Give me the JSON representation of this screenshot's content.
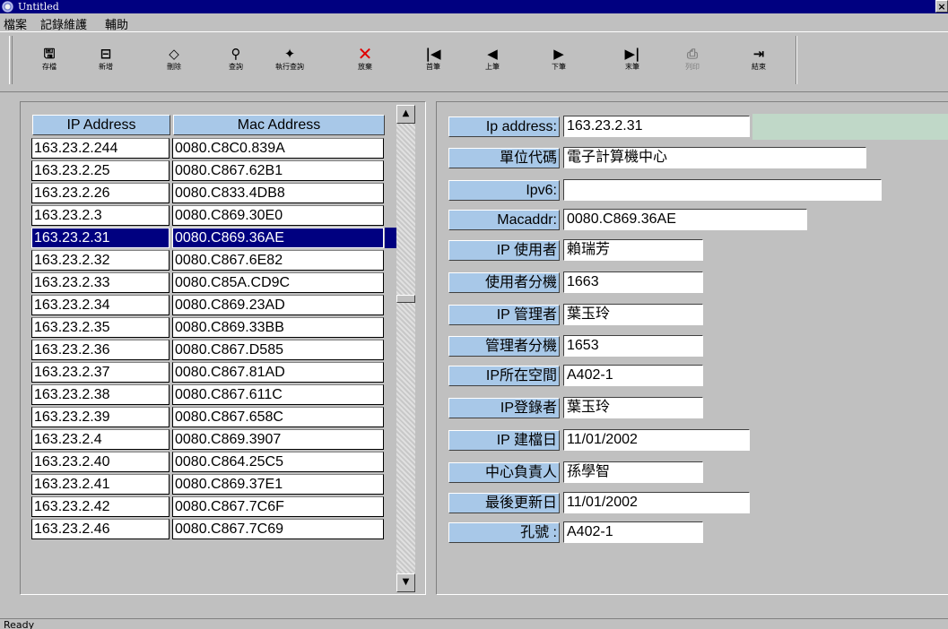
{
  "window": {
    "title": "Untitled",
    "close_glyph": "×"
  },
  "menu": [
    "檔案",
    "記錄維護",
    "輔助"
  ],
  "toolbar": [
    {
      "icon": "save-icon",
      "glyph": "🖫",
      "label": "存檔",
      "enabled": true
    },
    {
      "icon": "new-record-icon",
      "glyph": "⊟",
      "label": "新增",
      "enabled": true
    },
    {
      "icon": "erase-icon",
      "glyph": "◇",
      "label": "刪除",
      "enabled": true
    },
    {
      "icon": "query-icon",
      "glyph": "⚲",
      "label": "查詢",
      "enabled": true
    },
    {
      "icon": "execute-query-icon",
      "glyph": "✦",
      "label": "執行查詢",
      "enabled": true
    },
    {
      "icon": "cancel-icon",
      "glyph": "✕",
      "label": "放棄",
      "enabled": true
    },
    {
      "icon": "first-record-icon",
      "glyph": "|◀",
      "label": "首筆",
      "enabled": true
    },
    {
      "icon": "previous-record-icon",
      "glyph": "◀",
      "label": "上筆",
      "enabled": true
    },
    {
      "icon": "next-record-icon",
      "glyph": "▶",
      "label": "下筆",
      "enabled": true
    },
    {
      "icon": "last-record-icon",
      "glyph": "▶|",
      "label": "末筆",
      "enabled": true
    },
    {
      "icon": "print-icon",
      "glyph": "⎙",
      "label": "列印",
      "enabled": false
    },
    {
      "icon": "exit-icon",
      "glyph": "⇥",
      "label": "結束",
      "enabled": true
    }
  ],
  "list": {
    "columns": [
      "IP Address",
      "Mac Address"
    ],
    "selected_index": 4,
    "rows": [
      [
        "163.23.2.244",
        "0080.C8C0.839A"
      ],
      [
        "163.23.2.25",
        "0080.C867.62B1"
      ],
      [
        "163.23.2.26",
        "0080.C833.4DB8"
      ],
      [
        "163.23.2.3",
        "0080.C869.30E0"
      ],
      [
        "163.23.2.31",
        "0080.C869.36AE"
      ],
      [
        "163.23.2.32",
        "0080.C867.6E82"
      ],
      [
        "163.23.2.33",
        "0080.C85A.CD9C"
      ],
      [
        "163.23.2.34",
        "0080.C869.23AD"
      ],
      [
        "163.23.2.35",
        "0080.C869.33BB"
      ],
      [
        "163.23.2.36",
        "0080.C867.D585"
      ],
      [
        "163.23.2.37",
        "0080.C867.81AD"
      ],
      [
        "163.23.2.38",
        "0080.C867.611C"
      ],
      [
        "163.23.2.39",
        "0080.C867.658C"
      ],
      [
        "163.23.2.4",
        "0080.C869.3907"
      ],
      [
        "163.23.2.40",
        "0080.C864.25C5"
      ],
      [
        "163.23.2.41",
        "0080.C869.37E1"
      ],
      [
        "163.23.2.42",
        "0080.C867.7C6F"
      ],
      [
        "163.23.2.46",
        "0080.C867.7C69"
      ]
    ],
    "scroll_up_glyph": "▲",
    "scroll_down_glyph": "▼"
  },
  "details": [
    {
      "key": "ip-address",
      "label": "Ip address:",
      "value": "163.23.2.31"
    },
    {
      "key": "unit-code",
      "label": "單位代碼",
      "value": "電子計算機中心"
    },
    {
      "key": "ipv6",
      "label": "Ipv6:",
      "value": ""
    },
    {
      "key": "macaddr",
      "label": "Macaddr:",
      "value": "0080.C869.36AE"
    },
    {
      "key": "ip-user",
      "label": "IP 使用者",
      "value": "賴瑞芳"
    },
    {
      "key": "user-extension",
      "label": "使用者分機",
      "value": "1663"
    },
    {
      "key": "ip-manager",
      "label": "IP 管理者",
      "value": "葉玉玲"
    },
    {
      "key": "manager-extension",
      "label": "管理者分機",
      "value": "1653"
    },
    {
      "key": "ip-location",
      "label": "IP所在空間",
      "value": "A402-1"
    },
    {
      "key": "ip-registrar",
      "label": "IP登錄者",
      "value": "葉玉玲"
    },
    {
      "key": "ip-created-date",
      "label": "IP 建檔日",
      "value": "11/01/2002"
    },
    {
      "key": "center-owner",
      "label": "中心負責人",
      "value": "孫學智"
    },
    {
      "key": "last-updated",
      "label": "最後更新日",
      "value": "11/01/2002"
    },
    {
      "key": "port-number",
      "label": "孔號 :",
      "value": "A402-1"
    }
  ],
  "status": {
    "text": "Ready"
  }
}
